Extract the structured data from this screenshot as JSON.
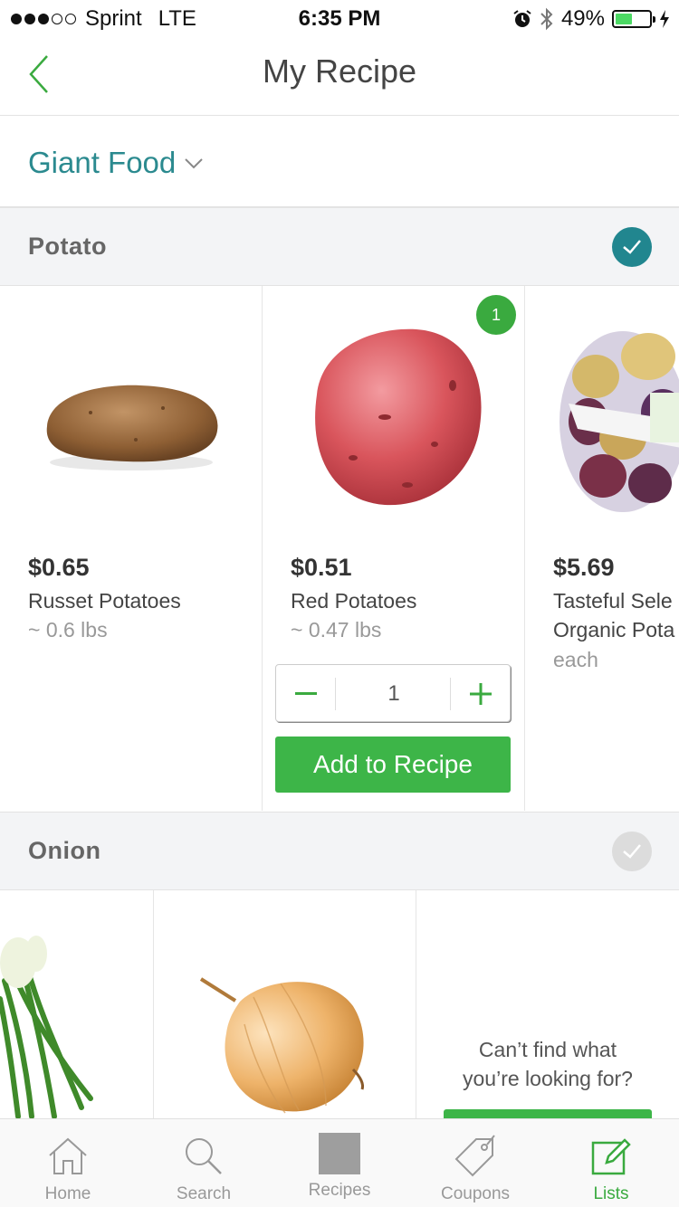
{
  "status_bar": {
    "carrier": "Sprint",
    "network": "LTE",
    "time": "6:35 PM",
    "battery": "49%"
  },
  "nav": {
    "title": "My Recipe"
  },
  "store": {
    "name": "Giant Food"
  },
  "sections": [
    {
      "title": "Potato",
      "checked": true,
      "products": [
        {
          "price": "$0.65",
          "name": "Russet Potatoes",
          "detail": "~ 0.6 lbs"
        },
        {
          "price": "$0.51",
          "name": "Red Potatoes",
          "detail": "~ 0.47 lbs",
          "badge": "1",
          "quantity": "1",
          "add_label": "Add to Recipe"
        },
        {
          "price": "$5.69",
          "name_line1": "Tasteful Sele",
          "name_line2": "Organic Pota",
          "detail": "each"
        }
      ]
    },
    {
      "title": "Onion",
      "checked": false,
      "cant_find_line1": "Can’t find what",
      "cant_find_line2": "you’re looking for?"
    }
  ],
  "tabs": [
    {
      "label": "Home",
      "icon": "home-icon"
    },
    {
      "label": "Search",
      "icon": "search-icon"
    },
    {
      "label": "Recipes",
      "icon": "recipes-icon"
    },
    {
      "label": "Coupons",
      "icon": "coupon-tag-icon"
    },
    {
      "label": "Lists",
      "icon": "edit-list-icon"
    }
  ],
  "colors": {
    "accent_green": "#3db548",
    "teal": "#21868f",
    "store_teal": "#2b8a8f"
  }
}
